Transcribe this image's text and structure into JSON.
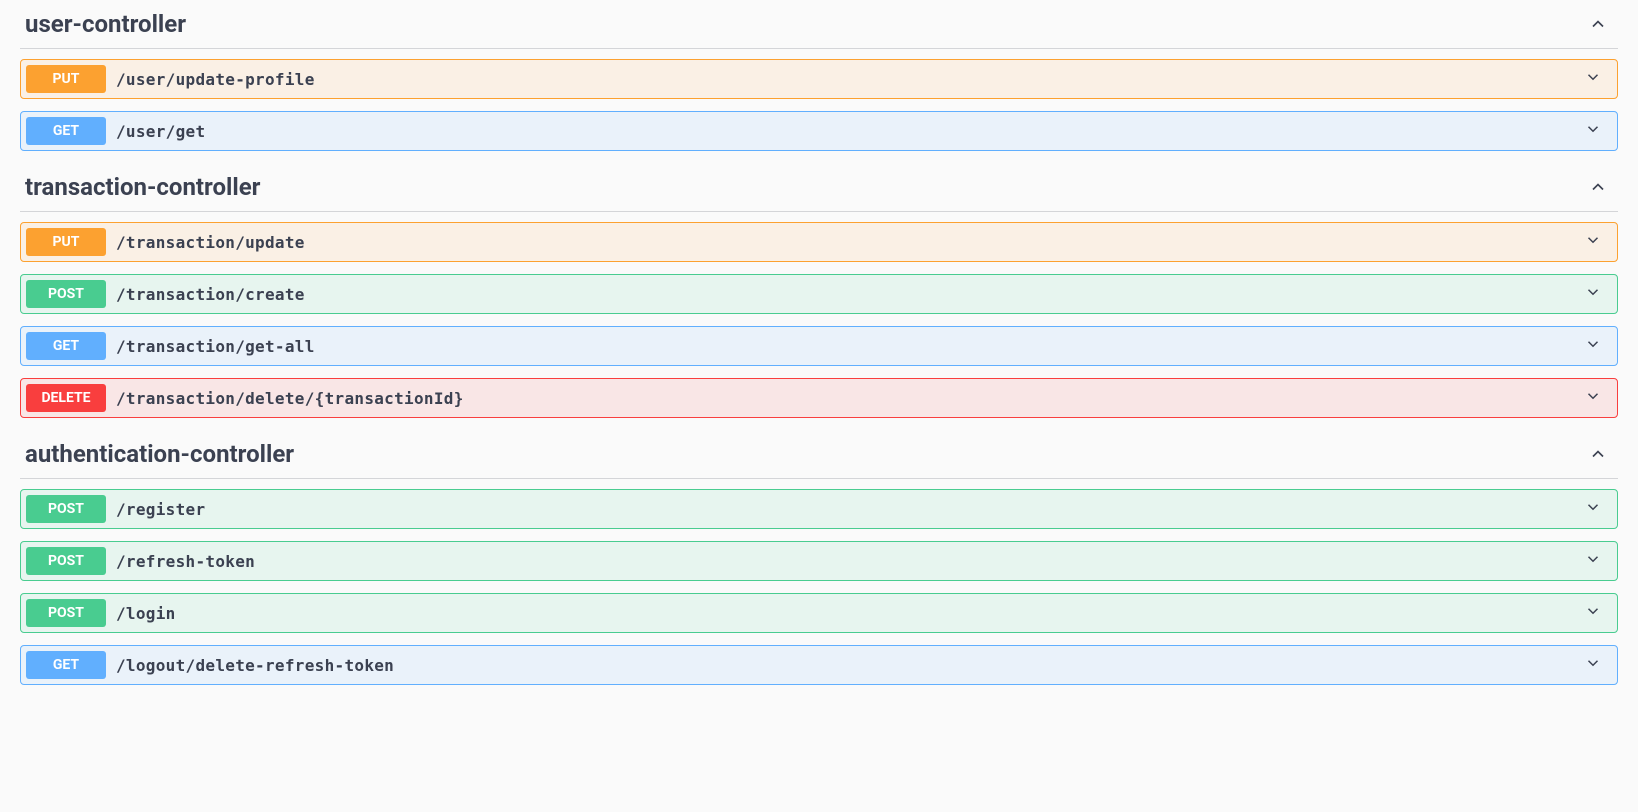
{
  "tags": [
    {
      "name": "user-controller",
      "operations": [
        {
          "method": "PUT",
          "path": "/user/update-profile"
        },
        {
          "method": "GET",
          "path": "/user/get"
        }
      ]
    },
    {
      "name": "transaction-controller",
      "operations": [
        {
          "method": "PUT",
          "path": "/transaction/update"
        },
        {
          "method": "POST",
          "path": "/transaction/create"
        },
        {
          "method": "GET",
          "path": "/transaction/get-all"
        },
        {
          "method": "DELETE",
          "path": "/transaction/delete/{transactionId}"
        }
      ]
    },
    {
      "name": "authentication-controller",
      "operations": [
        {
          "method": "POST",
          "path": "/register"
        },
        {
          "method": "POST",
          "path": "/refresh-token"
        },
        {
          "method": "POST",
          "path": "/login"
        },
        {
          "method": "GET",
          "path": "/logout/delete-refresh-token"
        }
      ]
    }
  ]
}
